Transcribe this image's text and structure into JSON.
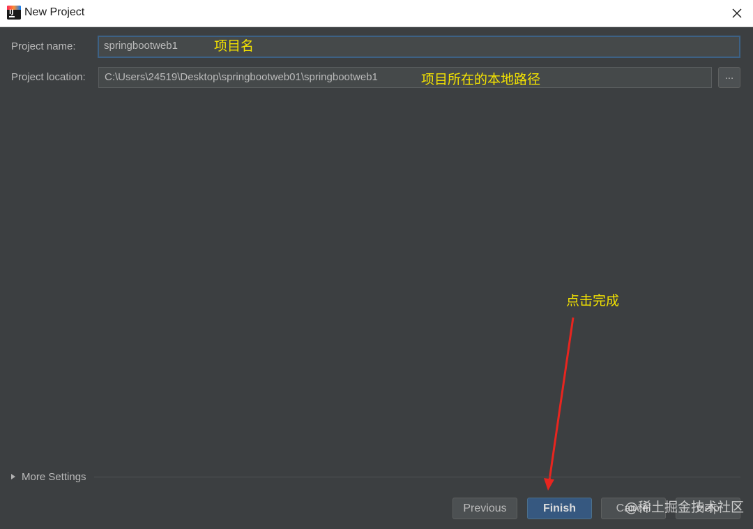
{
  "window": {
    "title": "New Project",
    "app_icon_text": "IJ"
  },
  "form": {
    "name_label": "Project name:",
    "name_value": "springbootweb1",
    "location_label": "Project location:",
    "location_value": "C:\\Users\\24519\\Desktop\\springbootweb01\\springbootweb1",
    "browse_label": "..."
  },
  "annotations": {
    "name_note": "项目名",
    "location_note": "项目所在的本地路径",
    "finish_note": "点击完成"
  },
  "more_settings": {
    "label": "More Settings"
  },
  "buttons": {
    "previous": "Previous",
    "finish": "Finish",
    "cancel": "Cancel",
    "help": "Help"
  },
  "watermark": "@稀土掘金技术社区",
  "colors": {
    "background": "#3c3f41",
    "field": "#45494a",
    "focus_border": "#3d6185",
    "primary_button": "#365880",
    "annotation": "#f5e400",
    "arrow": "#e8251f"
  }
}
